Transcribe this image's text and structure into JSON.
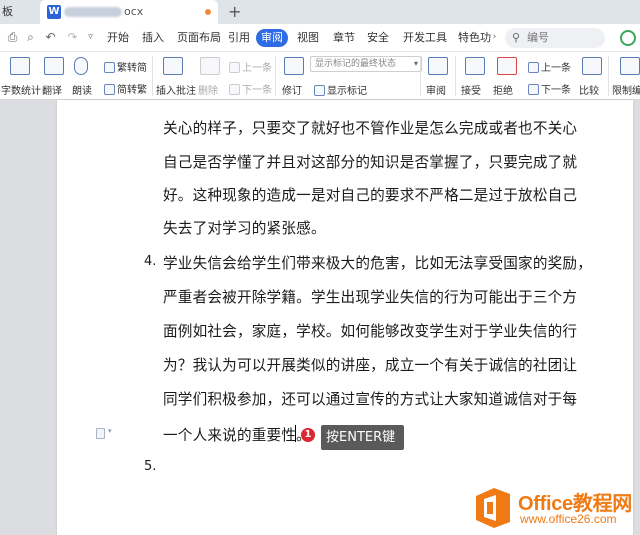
{
  "tabs": {
    "first": "板",
    "doc_fragment": "ocx",
    "new_tab": "+"
  },
  "menu": {
    "items": [
      "开始",
      "插入",
      "页面布局",
      "引用",
      "审阅",
      "视图",
      "章节",
      "安全",
      "开发工具",
      "特色功"
    ],
    "active": "审阅",
    "search_placeholder": "编号"
  },
  "ribbon": {
    "word_count": "字数统计",
    "translate": "翻译",
    "read_aloud": "朗读",
    "trad_to_simp": "繁转简",
    "simp_to_trad": "简转繁",
    "insert_comment": "插入批注",
    "delete": "删除",
    "prev_item_1": "上一条",
    "next_item_1": "下一条",
    "revise": "修订",
    "display_mode": "显示标记的最终状态",
    "show_markup": "显示标记",
    "review": "审阅",
    "accept": "接受",
    "reject": "拒绝",
    "prev_item_2": "上一条",
    "next_item_2": "下一条",
    "compare": "比较",
    "restrict_edit": "限制编"
  },
  "document": {
    "lines": [
      "关心的样子，只要交了就好也不管作业是怎么完成或者也不关心",
      "自己是否学懂了并且对这部分的知识是否掌握了，只要完成了就",
      "好。这种现象的造成一是对自己的要求不严格二是过于放松自己",
      "失去了对学习的紧张感。",
      "学业失信会给学生们带来极大的危害，比如无法享受国家的奖励，",
      "严重者会被开除学籍。学生出现学业失信的行为可能出于三个方",
      "面例如社会，家庭，学校。如何能够改变学生对于学业失信的行",
      "为？我认为可以开展类似的讲座，成立一个有关于诚信的社团让",
      "同学们积极参加，还可以通过宣传的方式让大家知道诚信对于每",
      "一个人来说的重要性。"
    ],
    "item4_number": "4.",
    "item5_number": "5.",
    "badge_number": "1",
    "tooltip": "按ENTER键"
  },
  "watermark": {
    "title": "Office教程网",
    "url": "www.office26.com"
  },
  "colors": {
    "accent_blue": "#2e6be6",
    "badge_red": "#d9282f",
    "watermark_orange": "#f07b15"
  }
}
